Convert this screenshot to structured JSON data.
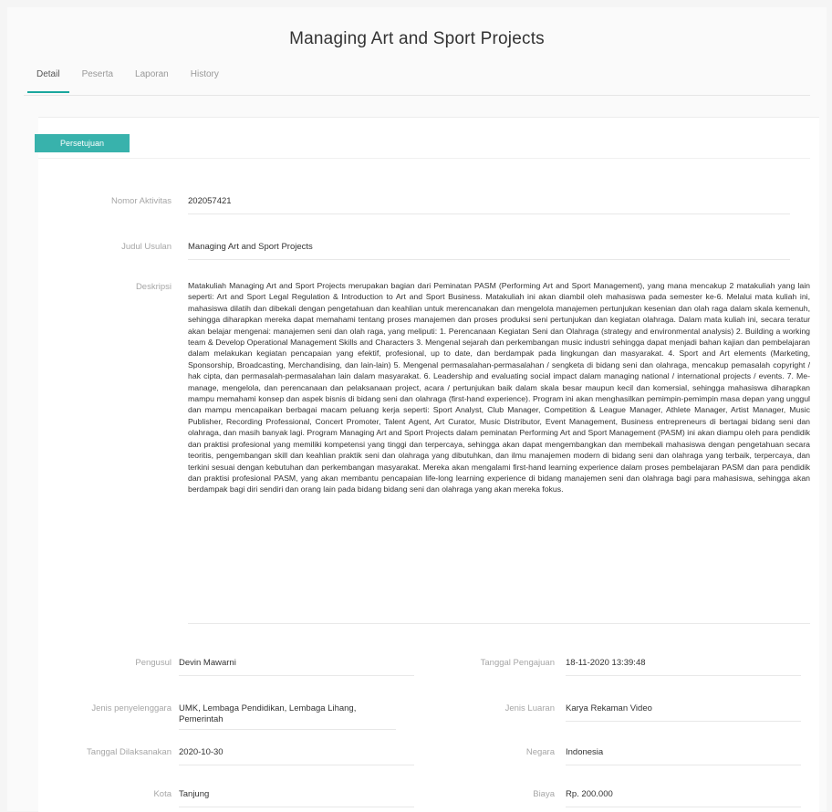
{
  "header": {
    "title": "Managing Art and Sport Projects"
  },
  "tabs": [
    {
      "label": "Detail"
    },
    {
      "label": "Peserta"
    },
    {
      "label": "Laporan"
    },
    {
      "label": "History"
    }
  ],
  "status": {
    "label": "Persetujuan"
  },
  "fields": {
    "nomor_aktivitas": {
      "label": "Nomor Aktivitas",
      "value": "202057421"
    },
    "judul_usulan": {
      "label": "Judul Usulan",
      "value": "Managing Art and Sport Projects"
    },
    "deskripsi": {
      "label": "Deskripsi",
      "value": "Matakuliah Managing Art and Sport Projects merupakan bagian dari Peminatan PASM (Performing Art and Sport Management), yang mana mencakup 2 matakuliah yang lain seperti: Art and Sport Legal Regulation & Introduction to Art and Sport Business. Matakuliah ini akan diambil oleh mahasiswa pada semester ke-6. Melalui mata kuliah ini, mahasiswa dilatih dan dibekali dengan pengetahuan dan keahlian untuk merencanakan dan mengelola manajemen pertunjukan kesenian dan olah raga dalam skala kemenuh, sehingga diharapkan mereka dapat memahami tentang proses manajemen dan proses produksi seni pertunjukan dan kegiatan olahraga. Dalam mata kuliah ini, secara teratur akan belajar mengenai: manajemen seni dan olah raga, yang meliputi: 1. Perencanaan Kegiatan Seni dan Olahraga (strategy and environmental analysis) 2. Building a working team & Develop Operational Management Skills and Characters 3. Mengenal sejarah dan perkembangan music industri sehingga dapat menjadi bahan kajian dan pembelajaran dalam melakukan kegiatan pencapaian yang efektif, profesional, up to date, dan berdampak pada lingkungan dan masyarakat. 4. Sport and Art elements (Marketing, Sponsorship, Broadcasting, Merchandising, dan lain-lain) 5. Mengenal permasalahan-permasalahan / sengketa di bidang seni dan olahraga, mencakup pemasalah copyright / hak cipta, dan permasalah-permasalahan lain dalam masyarakat. 6. Leadership and evaluating social impact dalam managing national / international projects / events. 7. Me-manage, mengelola, dan perencanaan dan pelaksanaan project, acara / pertunjukan baik dalam skala besar maupun kecil dan komersial, sehingga mahasiswa diharapkan mampu memahami konsep dan aspek bisnis di bidang seni dan olahraga (first-hand experience). Program ini akan menghasilkan pemimpin-pemimpin masa depan yang unggul dan mampu mencapaikan berbagai macam peluang kerja seperti: Sport Analyst, Club Manager, Competition & League Manager, Athlete Manager, Artist Manager, Music Publisher, Recording Professional, Concert Promoter, Talent Agent, Art Curator, Music Distributor, Event Management, Business entrepreneurs di bertagai bidang seni dan olahraga, dan masih banyak lagi. Program Managing Art and Sport Projects dalam peminatan Performing Art and Sport Management (PASM) ini akan diampu oleh para pendidik dan praktisi profesional yang memiliki kompetensi yang tinggi dan terpercaya, sehingga akan dapat mengembangkan dan membekali mahasiswa dengan pengetahuan secara teoritis, pengembangan skill dan keahlian praktik seni dan olahraga yang dibutuhkan, dan ilmu manajemen modern di bidang seni dan olahraga yang terbaik, terpercaya, dan terkini sesuai dengan kebutuhan dan perkembangan masyarakat. Mereka akan mengalami first-hand learning experience dalam proses pembelajaran PASM dan para pendidik dan praktisi profesional PASM, yang akan membantu pencapaian life-long learning experience di bidang manajemen seni dan olahraga bagi para mahasiswa, sehingga akan berdampak bagi diri sendiri dan orang lain pada bidang bidang seni dan olahraga yang akan mereka fokus."
    },
    "pengusul": {
      "label": "Pengusul",
      "value": "Devin Mawarni"
    },
    "tanggal_pengajuan": {
      "label": "Tanggal Pengajuan",
      "value": "18-11-2020 13:39:48"
    },
    "jenis_penyelenggara": {
      "label": "Jenis penyelenggara",
      "value": "UMK, Lembaga Pendidikan, Lembaga Lihang, Pemerintah"
    },
    "jenis_luaran": {
      "label": "Jenis Luaran",
      "value": "Karya Rekaman Video"
    },
    "tanggal_dilaksanakan": {
      "label": "Tanggal Dilaksanakan",
      "value": "2020-10-30"
    },
    "negara": {
      "label": "Negara",
      "value": "Indonesia"
    },
    "kota": {
      "label": "Kota",
      "value": "Tanjung"
    },
    "biaya": {
      "label": "Biaya",
      "value": "Rp. 200.000"
    }
  },
  "colors": {
    "accent": "#38b2ac",
    "tab_underline": "#1aa79e",
    "label": "#a6a6a6",
    "text": "#333333"
  }
}
